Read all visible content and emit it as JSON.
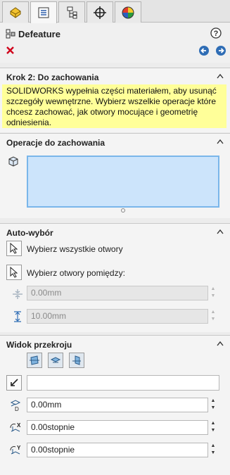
{
  "tabs": [
    {
      "icon": "feature-manager-icon",
      "active": false
    },
    {
      "icon": "property-manager-icon",
      "active": true
    },
    {
      "icon": "configuration-manager-icon",
      "active": false
    },
    {
      "icon": "dimxpert-icon",
      "active": false
    },
    {
      "icon": "display-manager-icon",
      "active": false
    }
  ],
  "header": {
    "title": "Defeature",
    "help_icon": "help-icon",
    "close_icon": "close-icon",
    "back_icon": "back-arrow-icon",
    "next_icon": "next-arrow-icon"
  },
  "step": {
    "title": "Krok 2: Do zachowania",
    "message_lines": [
      "SOLIDWORKS wypełnia części materiałem, aby usunąć",
      "szczegóły wewnętrzne. Wybierz wszelkie operacje które",
      "chcesz zachować, jak otwory mocujące i geometrię",
      "odniesienia."
    ]
  },
  "features": {
    "title": "Operacje do zachowania",
    "icon": "body-cube-icon",
    "selection_items": []
  },
  "auto": {
    "title": "Auto-wybór",
    "select_all": "Wybierz wszystkie otwory",
    "select_between": "Wybierz otwory pomiędzy:",
    "min_value": "0.00mm",
    "max_value": "10.00mm"
  },
  "section_view": {
    "title": "Widok przekroju",
    "reference_value": "",
    "offset_value": "0.00mm",
    "rot_x_value": "0.00stopnie",
    "rot_y_value": "0.00stopnie"
  },
  "colors": {
    "note_bg": "#ffff99",
    "selection_bg": "#cce4fb",
    "selection_border": "#7ab6ea",
    "close_red": "#d0021b",
    "nav_blue": "#2f6db5"
  }
}
